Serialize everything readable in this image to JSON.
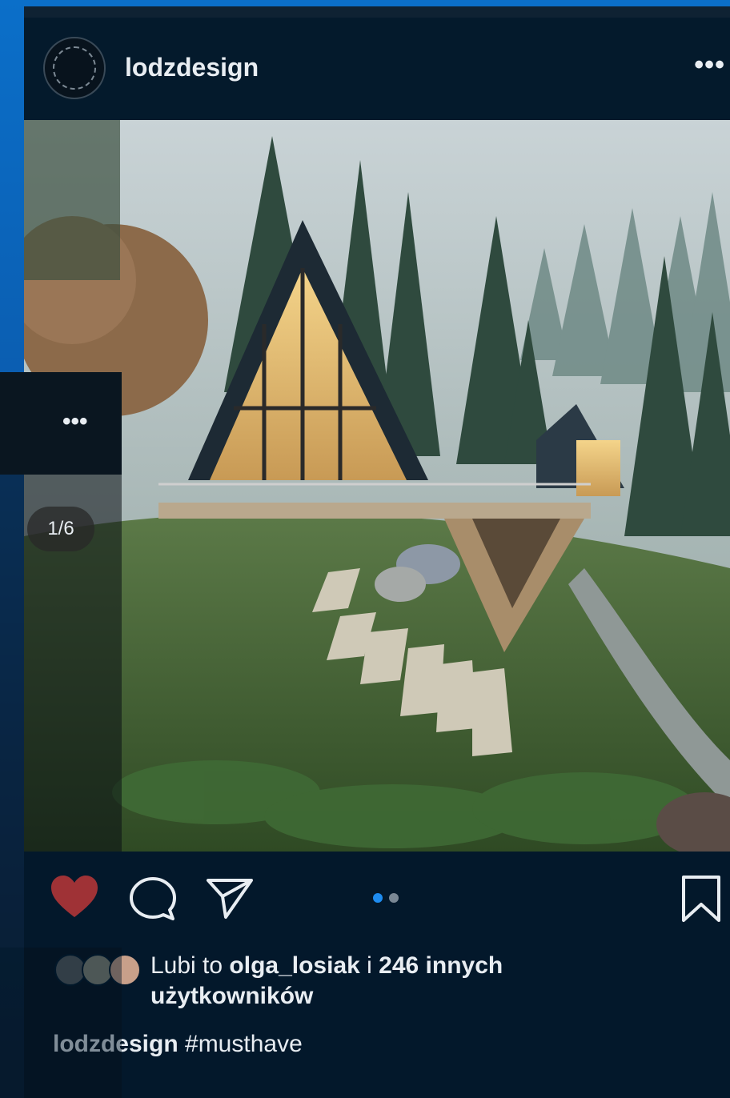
{
  "post": {
    "username": "lodzdesign",
    "more_glyph": "•••",
    "image_counter": "1/6",
    "likes": {
      "prefix": "Lubi to ",
      "user": "olga_losiak",
      "middle": " i ",
      "count_text": "246 innych",
      "suffix": "użytkowników"
    },
    "caption": {
      "username": "lodzdesign",
      "text": " #musthave"
    },
    "carousel": {
      "current": 1,
      "total": 2
    }
  },
  "icons": {
    "like": "heart-icon",
    "comment": "comment-icon",
    "share": "send-icon",
    "save": "bookmark-icon",
    "more": "more-icon"
  },
  "colors": {
    "background": "#03182b",
    "accent_blue": "#0b6fc9",
    "heart_red": "#c73a3a",
    "active_dot": "#1e8cf0",
    "inactive_dot": "#7a8794"
  }
}
